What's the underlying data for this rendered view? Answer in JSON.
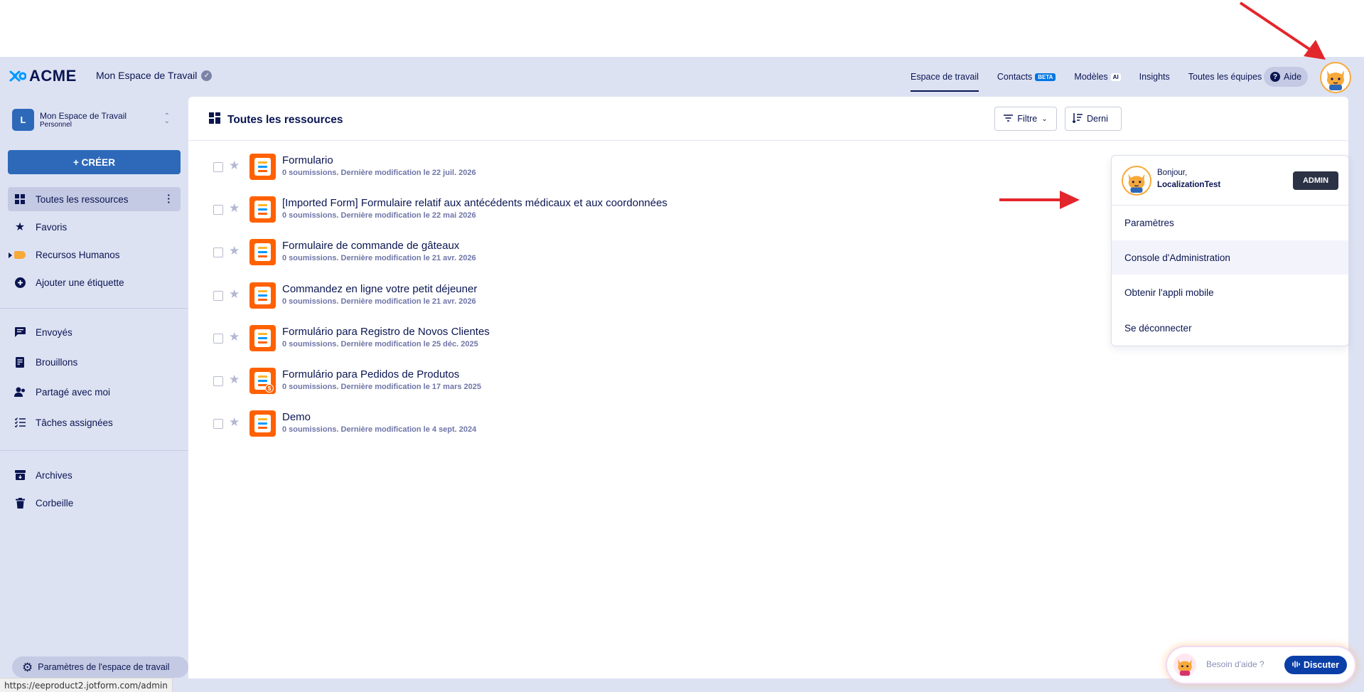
{
  "header": {
    "logo_text": "ACME",
    "workspace_title": "Mon Espace de Travail",
    "nav": [
      {
        "label": "Espace de travail",
        "badge": ""
      },
      {
        "label": "Contacts",
        "badge": "BETA"
      },
      {
        "label": "Modèles",
        "badge": "AI"
      },
      {
        "label": "Insights",
        "badge": ""
      },
      {
        "label": "Toutes les équipes",
        "badge": ""
      }
    ],
    "help_label": "Aide"
  },
  "sidebar": {
    "workspace_letter": "L",
    "workspace_name": "Mon Espace de Travail",
    "workspace_type": "Personnel",
    "create_label": "+ CRÉER",
    "items": [
      {
        "label": "Toutes les ressources",
        "icon": "grid-icon"
      },
      {
        "label": "Favoris",
        "icon": "star-icon"
      },
      {
        "label": "Recursos Humanos",
        "icon": "tag-icon"
      },
      {
        "label": "Ajouter une étiquette",
        "icon": "plus-circle-icon"
      },
      {
        "label": "Envoyés",
        "icon": "message-icon"
      },
      {
        "label": "Brouillons",
        "icon": "draft-icon"
      },
      {
        "label": "Partagé avec moi",
        "icon": "people-icon"
      },
      {
        "label": "Tâches assignées",
        "icon": "tasks-icon"
      },
      {
        "label": "Archives",
        "icon": "archive-icon"
      },
      {
        "label": "Corbeille",
        "icon": "trash-icon"
      }
    ],
    "settings_label": "Paramètres de l'espace de travail"
  },
  "main": {
    "title": "Toutes les ressources",
    "filter_label": "Filtre",
    "sort_label": "Derni",
    "forms": [
      {
        "title": "Formulario",
        "subtitle": "0 soumissions. Dernière modification le 22 juil. 2026",
        "payment": false
      },
      {
        "title": "[Imported Form] Formulaire relatif aux antécédents médicaux et aux coordonnées",
        "subtitle": "0 soumissions. Dernière modification le 22 mai 2026",
        "payment": false
      },
      {
        "title": "Formulaire de commande de gâteaux",
        "subtitle": "0 soumissions. Dernière modification le 21 avr. 2026",
        "payment": false
      },
      {
        "title": "Commandez en ligne votre petit déjeuner",
        "subtitle": "0 soumissions. Dernière modification le 21 avr. 2026",
        "payment": false
      },
      {
        "title": "Formulário para Registro de Novos Clientes",
        "subtitle": "0 soumissions. Dernière modification le 25 déc. 2025",
        "payment": false
      },
      {
        "title": "Formulário para Pedidos de Produtos",
        "subtitle": "0 soumissions. Dernière modification le 17 mars 2025",
        "payment": true
      },
      {
        "title": "Demo",
        "subtitle": "0 soumissions. Dernière modification le 4 sept. 2024",
        "payment": false
      }
    ]
  },
  "account_menu": {
    "greeting": "Bonjour,",
    "username": "LocalizationTest",
    "role_badge": "ADMIN",
    "items": [
      "Paramètres",
      "Console d'Administration",
      "Obtenir l'appli mobile",
      "Se déconnecter"
    ]
  },
  "chat": {
    "prompt": "Besoin d'aide ?",
    "button_label": "Discuter"
  },
  "status_url": "https://eeproduct2.jotform.com/admin",
  "colors": {
    "accent": "#2e69b9",
    "form_icon": "#ff6100",
    "annotation_arrow": "#e3262c",
    "navy": "#0a1551",
    "app_background": "#dde2f3"
  }
}
